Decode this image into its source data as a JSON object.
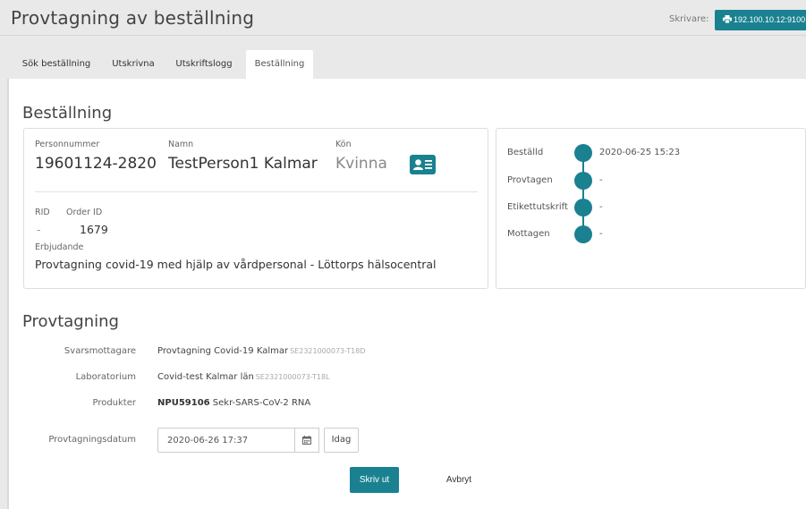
{
  "header": {
    "title": "Provtagning av beställning",
    "printer_label": "Skrivare:",
    "printer_value": "192.100.10.12:9100"
  },
  "tabs": [
    {
      "label": "Sök beställning"
    },
    {
      "label": "Utskrivna"
    },
    {
      "label": "Utskriftslogg"
    },
    {
      "label": "Beställning",
      "active": true
    }
  ],
  "order": {
    "section_title": "Beställning",
    "personnummer_label": "Personnummer",
    "personnummer": "19601124-2820",
    "namn_label": "Namn",
    "namn": "TestPerson1 Kalmar",
    "kon_label": "Kön",
    "kon": "Kvinna",
    "rid_label": "RID",
    "rid": "-",
    "orderid_label": "Order ID",
    "orderid": "1679",
    "erbjudande_label": "Erbjudande",
    "erbjudande": "Provtagning covid-19 med hjälp av vårdpersonal - Löttorps hälsocentral"
  },
  "timeline": [
    {
      "label": "Beställd",
      "value": "2020-06-25 15:23"
    },
    {
      "label": "Provtagen",
      "value": "-"
    },
    {
      "label": "Etikettutskrift",
      "value": "-"
    },
    {
      "label": "Mottagen",
      "value": "-"
    }
  ],
  "sampling": {
    "section_title": "Provtagning",
    "svarsmottagare_label": "Svarsmottagare",
    "svarsmottagare": "Provtagning Covid-19 Kalmar",
    "svarsmottagare_code": "SE2321000073-T18D",
    "laboratorium_label": "Laboratorium",
    "laboratorium": "Covid-test Kalmar län",
    "laboratorium_code": "SE2321000073-T18L",
    "produkter_label": "Produkter",
    "produkt_code": "NPU59106",
    "produkt_name": "Sekr-SARS-CoV-2 RNA",
    "datum_label": "Provtagningsdatum",
    "datum_value": "2020-06-26 17:37",
    "idag_label": "Idag",
    "print_label": "Skriv ut",
    "cancel_label": "Avbryt"
  },
  "colors": {
    "accent": "#1a8191"
  }
}
